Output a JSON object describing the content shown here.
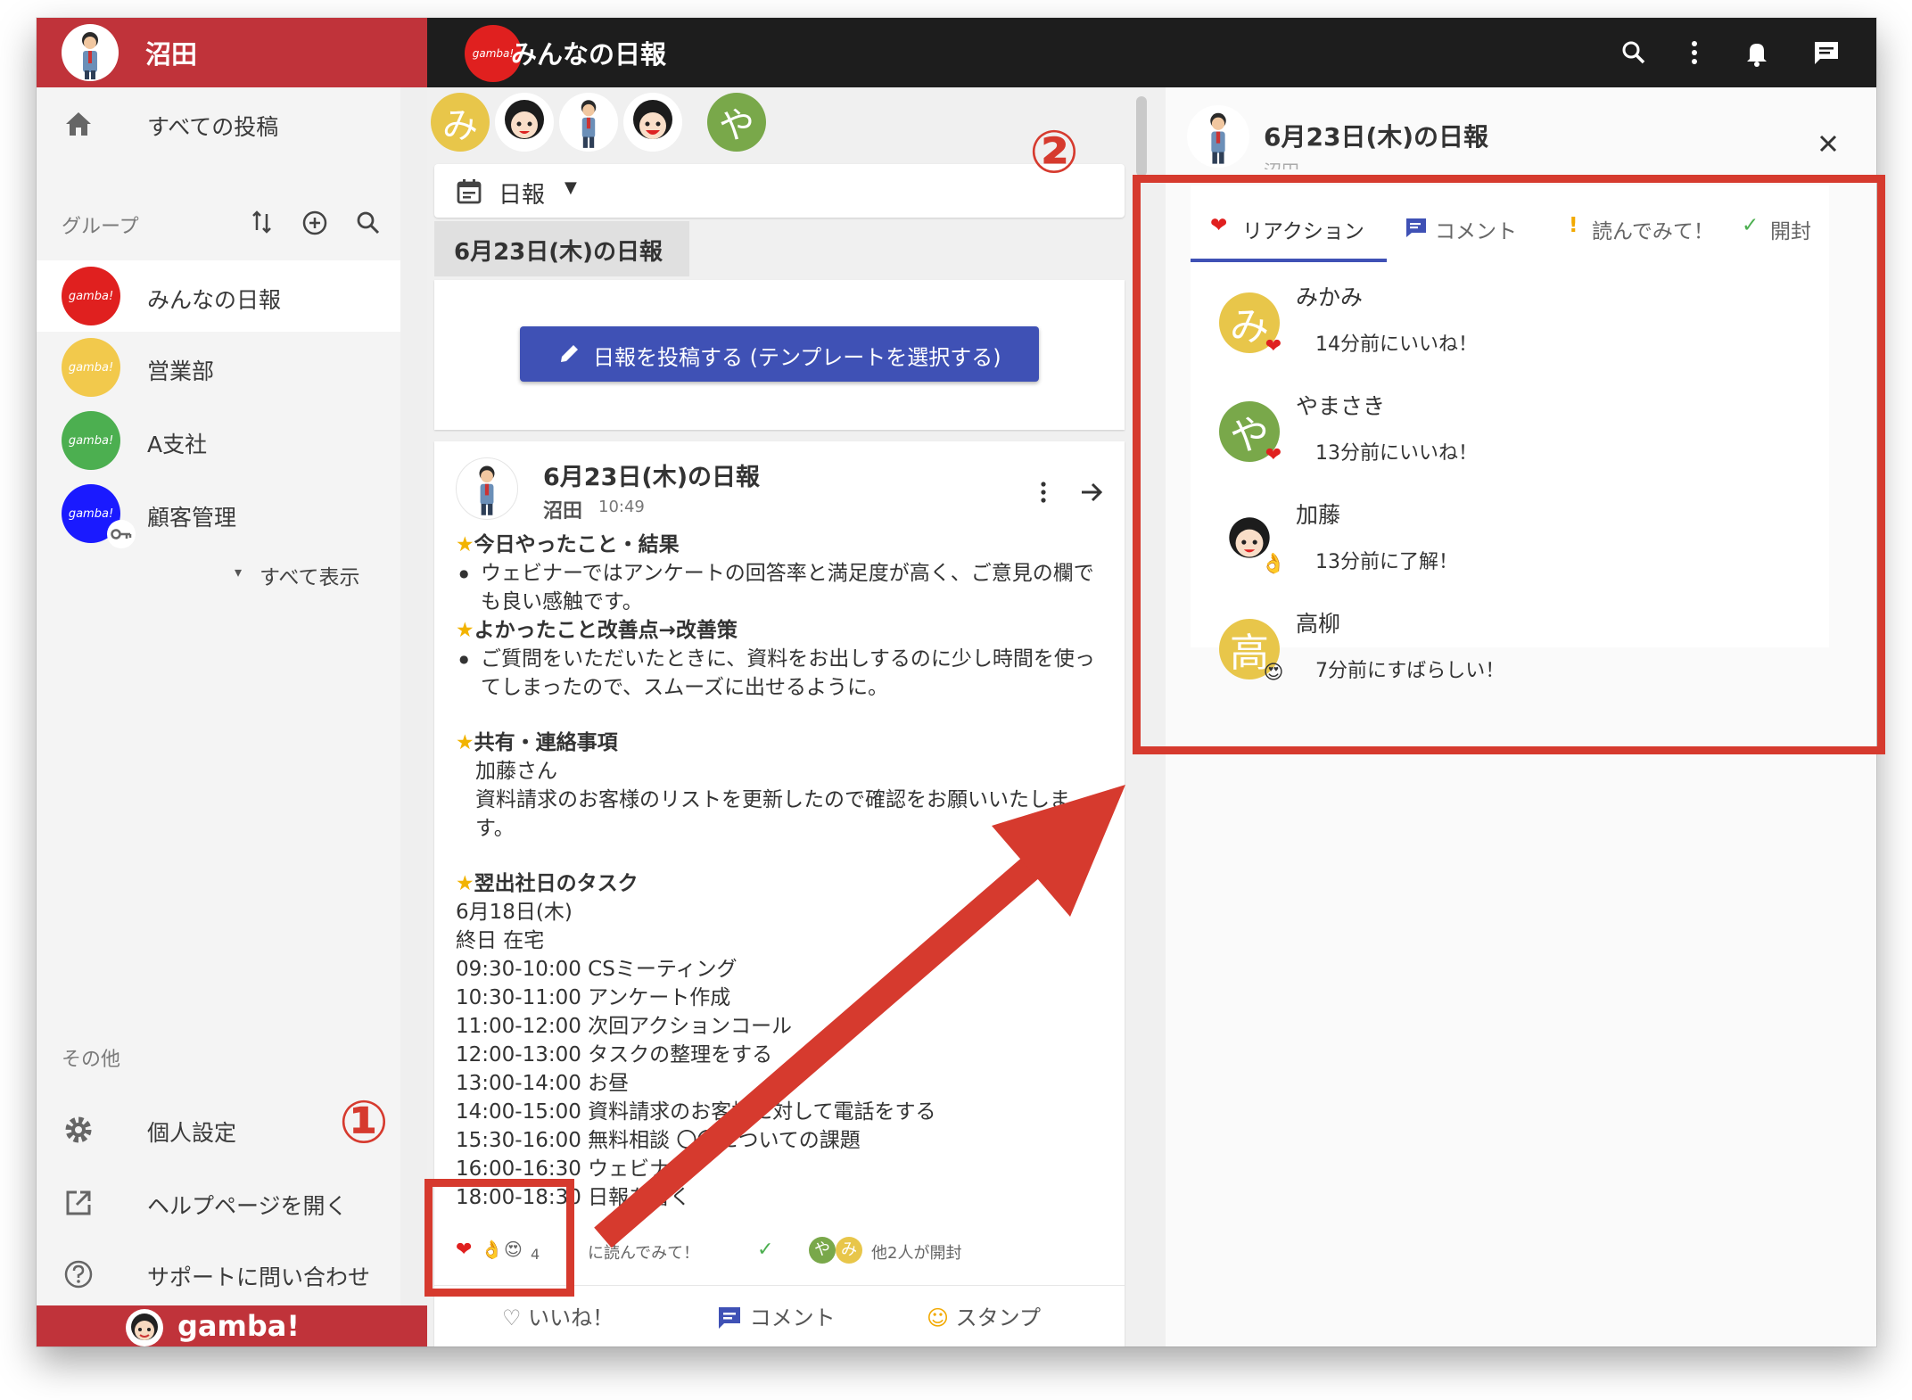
{
  "topbar": {
    "username": "沼田",
    "group_title": "みんなの日報",
    "logo_text": "gamba!",
    "icons": [
      "search-icon",
      "more-vert-icon",
      "bell-icon",
      "chat-icon"
    ]
  },
  "sidebar": {
    "all_posts": "すべての投稿",
    "groups_label": "グループ",
    "groups": [
      {
        "name": "みんなの日報",
        "color": "#e0201f",
        "logo": "gamba!"
      },
      {
        "name": "営業部",
        "color": "#f2c94c",
        "logo": "gamba!"
      },
      {
        "name": "A支社",
        "color": "#4caf50",
        "logo": "gamba!"
      },
      {
        "name": "顧客管理",
        "color": "#1a1aff",
        "logo": "gamba!"
      }
    ],
    "show_all": "すべて表示",
    "other_label": "その他",
    "settings": "個人設定",
    "help": "ヘルプページを開く",
    "support": "サポートに問い合わせ",
    "brand": "gamba!"
  },
  "feed": {
    "members": [
      {
        "initial": "み",
        "color": "#e8c64a"
      },
      {
        "initial": "",
        "color": "#ffffff"
      },
      {
        "initial": "",
        "color": "#ffffff"
      },
      {
        "initial": "",
        "color": "#ffffff"
      },
      {
        "initial": "や",
        "color": "#79a84a"
      }
    ],
    "filter_label": "日報",
    "date_chip": "6月23日(木)の日報",
    "post_template_button": "日報を投稿する (テンプレートを選択する)",
    "post": {
      "title": "6月23日(木)の日報",
      "author": "沼田",
      "time": "10:49",
      "sec1_head": "今日やったこと・結果",
      "sec1_b1": "ウェビナーではアンケートの回答率と満足度が高く、ご意見の欄でも良い感触です。",
      "sec2_head": "よかったこと改善点→改善策",
      "sec2_b1": "ご質問をいただいたときに、資料をお出しするのに少し時間を使ってしまったので、スムーズに出せるように。",
      "sec3_head": "共有・連絡事項",
      "sec3_l1": "加藤さん",
      "sec3_l2": "資料請求のお客様のリストを更新したので確認をお願いいたします。",
      "sec4_head": "翌出社日のタスク",
      "tasks": [
        "6月18日(木)",
        "終日 在宅",
        "09:30-10:00 CSミーティング",
        "10:30-11:00 アンケート作成",
        "11:00-12:00 次回アクションコール",
        "12:00-13:00 タスクの整理をする",
        "13:00-14:00 お昼",
        "14:00-15:00 資料請求のお客様に対して電話をする",
        "15:30-16:00 無料相談 〇〇についての課題",
        "16:00-16:30 ウェビナー",
        "18:00-18:30 日報を書く"
      ],
      "reaction_count": "4",
      "read_please_text": "に読んでみて！",
      "opened_text": "他2人が開封",
      "action_like": "いいね！",
      "action_comment": "コメント",
      "action_stamp": "スタンプ"
    }
  },
  "detail": {
    "title": "6月23日(木)の日報",
    "author": "沼田",
    "tabs": [
      {
        "label": "リアクション",
        "icon": "heart-icon",
        "color": "#e0201f"
      },
      {
        "label": "コメント",
        "icon": "comment-icon",
        "color": "#3f51b5"
      },
      {
        "label": "読んでみて！",
        "icon": "exclamation-icon",
        "color": "#f2a900"
      },
      {
        "label": "開封",
        "icon": "check-icon",
        "color": "#4caf50"
      }
    ],
    "reactions": [
      {
        "name": "みかみ",
        "text": "14分前にいいね！",
        "initial": "み",
        "color": "#e8c64a",
        "badge": "❤"
      },
      {
        "name": "やまさき",
        "text": "13分前にいいね！",
        "initial": "や",
        "color": "#79a84a",
        "badge": "❤"
      },
      {
        "name": "加藤",
        "text": "13分前に了解！",
        "initial": "",
        "color": "#ffffff",
        "badge": "👌"
      },
      {
        "name": "高柳",
        "text": "7分前にすばらしい！",
        "initial": "高",
        "color": "#e8c64a",
        "badge": "😍"
      }
    ]
  },
  "annotations": {
    "num1": "①",
    "num2": "②"
  }
}
